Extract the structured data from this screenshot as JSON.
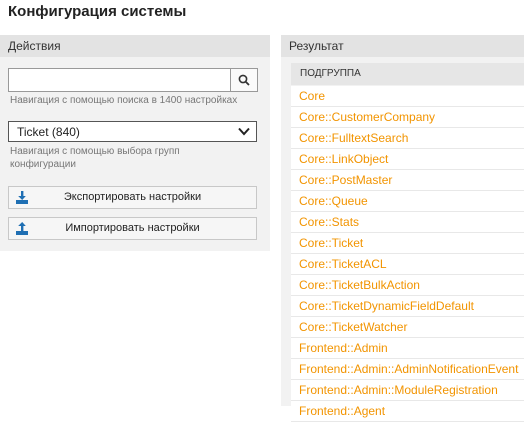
{
  "page": {
    "title": "Конфигурация системы"
  },
  "actions": {
    "header": "Действия",
    "search": {
      "value": "",
      "hint": "Навигация с помощью поиска в 1400 настройках"
    },
    "group_select": {
      "selected": "Ticket (840)",
      "hint_line1": "Навигация с помощью выбора групп",
      "hint_line2": "конфигурации"
    },
    "export_label": "Экспортировать настройки",
    "import_label": "Импортировать настройки"
  },
  "results": {
    "header": "Результат",
    "column_header": "ПОДГРУППА",
    "rows": [
      "Core",
      "Core::CustomerCompany",
      "Core::FulltextSearch",
      "Core::LinkObject",
      "Core::PostMaster",
      "Core::Queue",
      "Core::Stats",
      "Core::Ticket",
      "Core::TicketACL",
      "Core::TicketBulkAction",
      "Core::TicketDynamicFieldDefault",
      "Core::TicketWatcher",
      "Frontend::Admin",
      "Frontend::Admin::AdminNotificationEvent",
      "Frontend::Admin::ModuleRegistration",
      "Frontend::Agent"
    ]
  },
  "colors": {
    "link": "#f29400",
    "icon": "#1f6fb3"
  },
  "icons": {
    "search": "search-icon",
    "dropdown": "chevron-down-icon",
    "export": "export-icon",
    "import": "import-icon"
  }
}
